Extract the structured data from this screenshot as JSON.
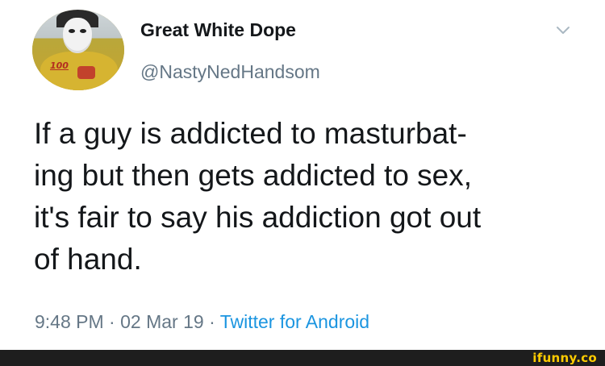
{
  "tweet": {
    "display_name": "Great White Dope",
    "handle": "@NastyNedHandsom",
    "text_lines": [
      "If a guy is addicted to masturbat-",
      "ing but then gets addicted to sex,",
      "it's fair to say his addiction got out",
      "of hand."
    ],
    "time": "9:48 PM",
    "separator": "·",
    "date": "02 Mar 19",
    "source": "Twitter for Android",
    "avatar_badge": "100",
    "menu_icon": "chevron-down-icon"
  },
  "watermark": {
    "text": "ifunny.co"
  },
  "colors": {
    "primary_text": "#14171a",
    "secondary_text": "#657786",
    "link": "#1b95e0",
    "footer_bg": "#1e1e1e",
    "watermark": "#ffcc00"
  }
}
